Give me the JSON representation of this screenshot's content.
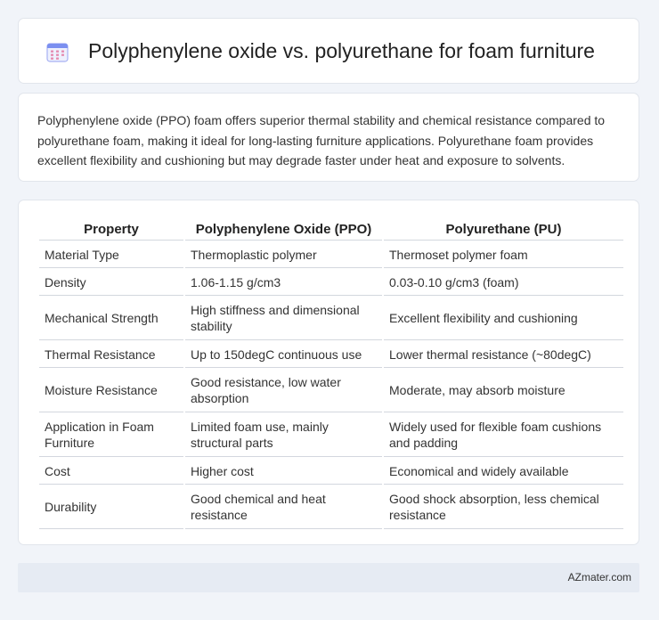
{
  "header": {
    "title": "Polyphenylene oxide vs. polyurethane for foam furniture",
    "icon": "calendar-icon",
    "icon_color": "#7b8ff0"
  },
  "intro": {
    "text": "Polyphenylene oxide (PPO) foam offers superior thermal stability and chemical resistance compared to polyurethane foam, making it ideal for long-lasting furniture applications. Polyurethane foam provides excellent flexibility and cushioning but may degrade faster under heat and exposure to solvents."
  },
  "table": {
    "headers": [
      "Property",
      "Polyphenylene Oxide (PPO)",
      "Polyurethane (PU)"
    ],
    "rows": [
      [
        "Material Type",
        "Thermoplastic polymer",
        "Thermoset polymer foam"
      ],
      [
        "Density",
        "1.06-1.15 g/cm3",
        "0.03-0.10 g/cm3 (foam)"
      ],
      [
        "Mechanical Strength",
        "High stiffness and dimensional stability",
        "Excellent flexibility and cushioning"
      ],
      [
        "Thermal Resistance",
        "Up to 150degC continuous use",
        "Lower thermal resistance (~80degC)"
      ],
      [
        "Moisture Resistance",
        "Good resistance, low water absorption",
        "Moderate, may absorb moisture"
      ],
      [
        "Application in Foam Furniture",
        "Limited foam use, mainly structural parts",
        "Widely used for flexible foam cushions and padding"
      ],
      [
        "Cost",
        "Higher cost",
        "Economical and widely available"
      ],
      [
        "Durability",
        "Good chemical and heat resistance",
        "Good shock absorption, less chemical resistance"
      ]
    ]
  },
  "footer": {
    "site": "AZmater.com"
  }
}
